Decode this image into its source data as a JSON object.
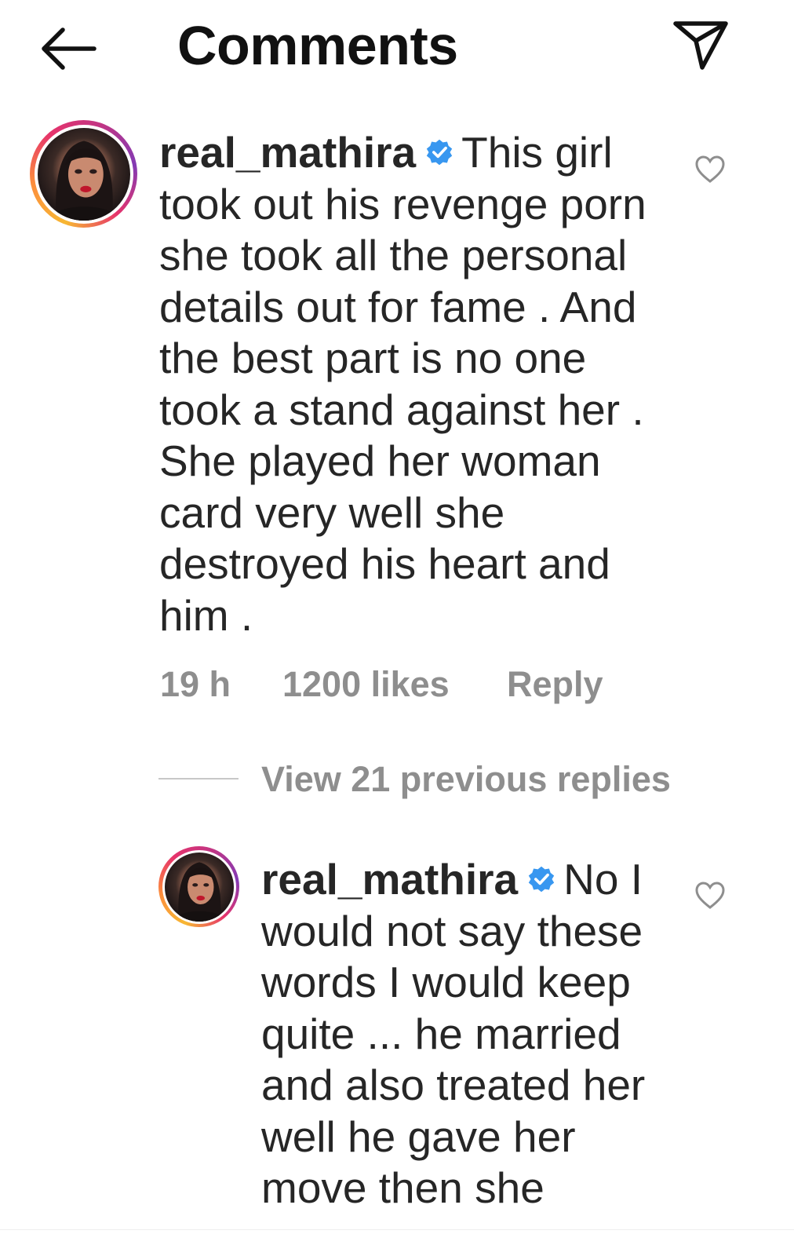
{
  "header": {
    "back_icon": "arrow-left-icon",
    "title": "Comments",
    "share_icon": "paper-plane-icon"
  },
  "comments": [
    {
      "username": "real_mathira",
      "verified": true,
      "text": "This girl took out his revenge porn she took all the personal details out for fame . And the best part is no one took a stand against her . She played her woman card very well she destroyed his heart and him .",
      "time": "19 h",
      "likes": "1200 likes",
      "reply_label": "Reply",
      "liked": false
    }
  ],
  "view_replies_label": "View 21 previous replies",
  "replies": [
    {
      "username": "real_mathira",
      "verified": true,
      "text": "No I would not say these words I would keep quite ... he married and also treated her well he gave her move then she",
      "liked": false
    }
  ],
  "colors": {
    "text": "#262626",
    "muted": "#8e8e8e",
    "verified_blue": "#3897f0",
    "ring_gradient": [
      "#f7b733",
      "#e6336b",
      "#c13584",
      "#833ab4"
    ]
  }
}
